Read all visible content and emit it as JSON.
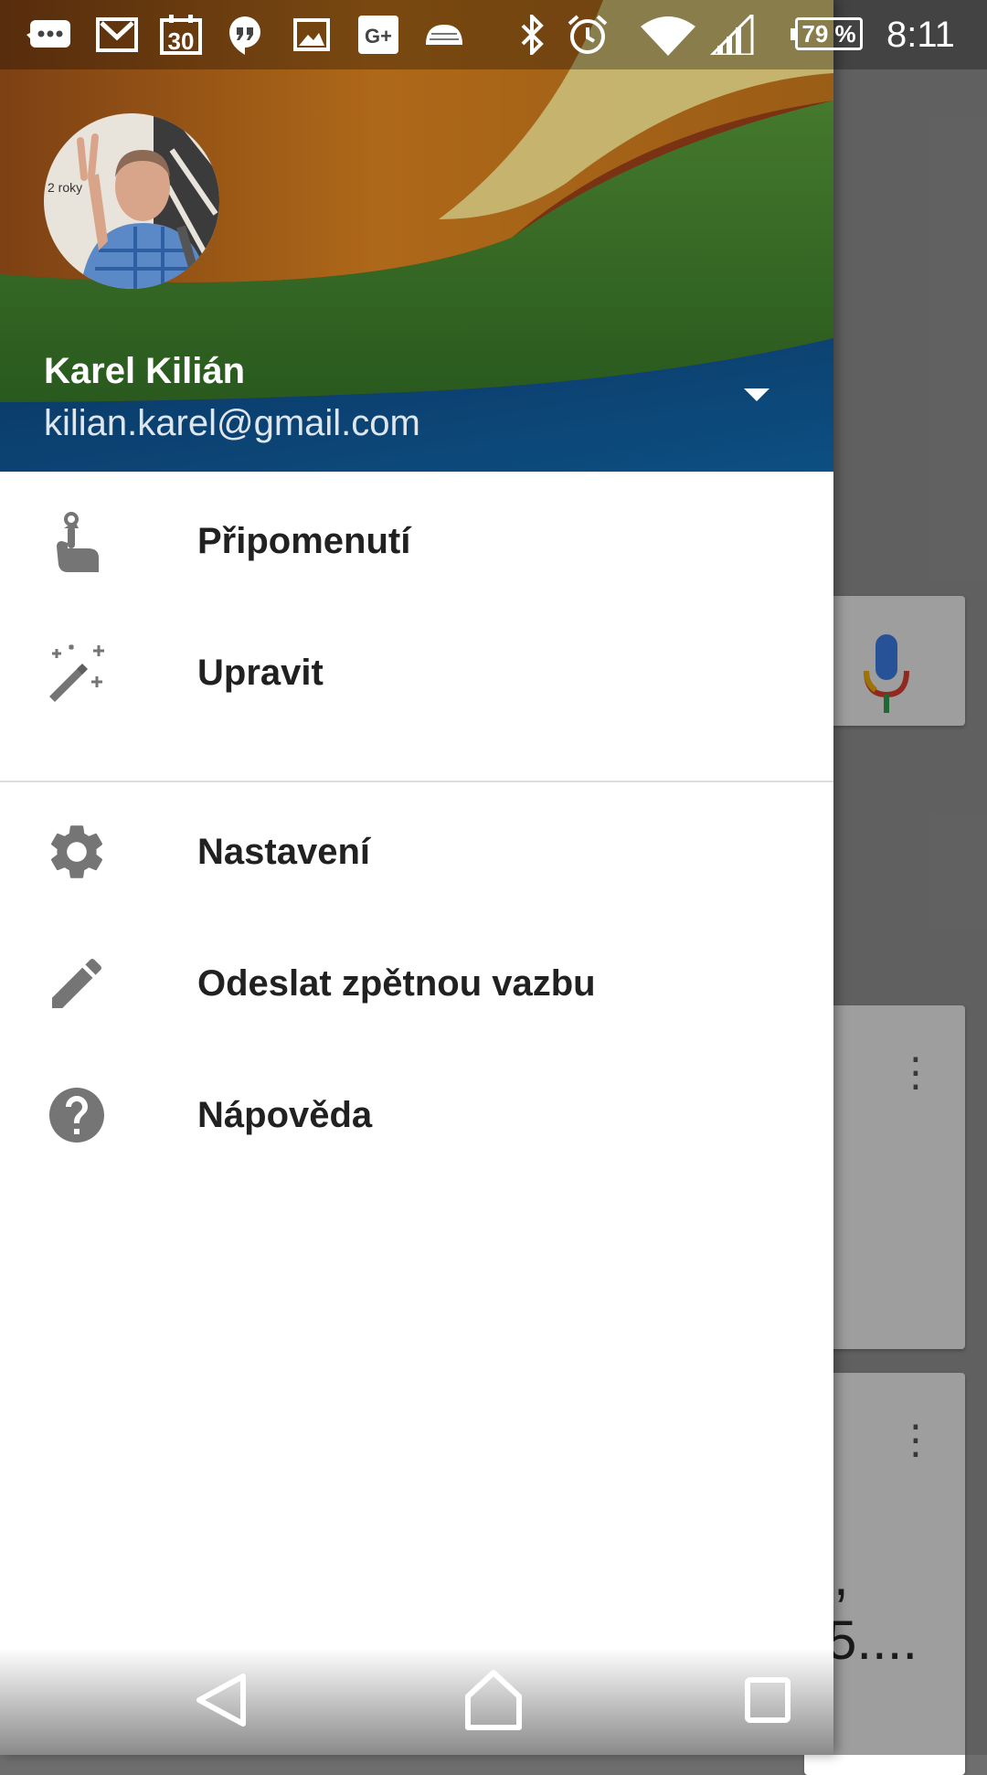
{
  "status_bar": {
    "icons": [
      "messaging-icon",
      "gmail-icon",
      "calendar-icon",
      "hangouts-icon",
      "gallery-icon",
      "google-plus-icon",
      "android-icon",
      "bluetooth-icon",
      "alarm-icon",
      "wifi-icon",
      "signal-icon",
      "battery-icon"
    ],
    "calendar_day": "30",
    "google_plus_label": "G+",
    "battery_percent": "79 %",
    "time": "8:11"
  },
  "drawer": {
    "account": {
      "name": "Karel Kilián",
      "email": "kilian.karel@gmail.com",
      "avatar_icon": "profile-photo"
    },
    "menu_primary": [
      {
        "label": "Připomenutí",
        "icon": "reminder-icon"
      },
      {
        "label": "Upravit",
        "icon": "magic-wand-icon"
      }
    ],
    "menu_secondary": [
      {
        "label": "Nastavení",
        "icon": "gear-icon"
      },
      {
        "label": "Odeslat zpětnou vazbu",
        "icon": "pencil-icon"
      },
      {
        "label": "Nápověda",
        "icon": "help-icon"
      }
    ]
  },
  "background_app": {
    "card_text_line1": ",",
    "card_text_line2": "5...."
  },
  "nav_bar": {
    "buttons": [
      "back-icon",
      "home-icon",
      "recents-icon"
    ]
  },
  "colors": {
    "drawer_bg": "#ffffff",
    "icon_gray": "#757575",
    "label_text": "#212121",
    "header_blue": "#0d4f8a",
    "header_green": "#3e7a2a",
    "header_orange": "#c9771c"
  }
}
